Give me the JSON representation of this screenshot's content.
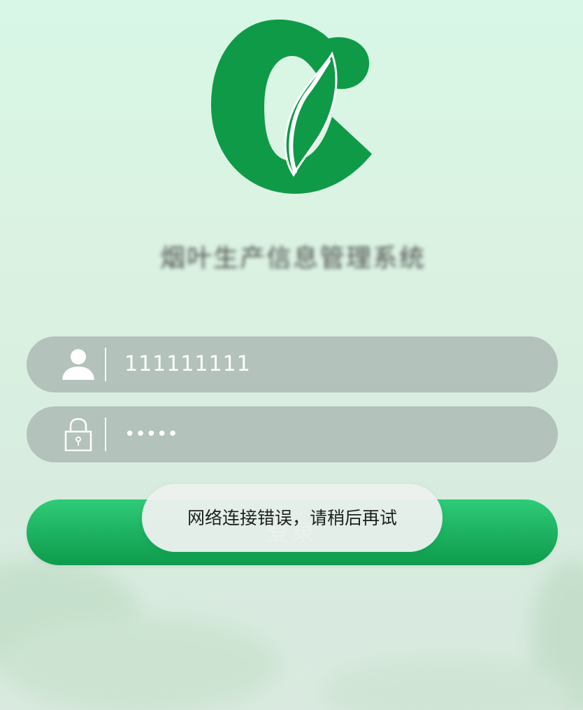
{
  "app": {
    "title": "烟叶生产信息管理系统",
    "logo": "green-c-leaf-logo"
  },
  "form": {
    "username": {
      "icon": "user-icon",
      "value": "111111111"
    },
    "password": {
      "icon": "lock-icon",
      "masked_value": "•••••"
    },
    "login_button": {
      "label": "登录"
    }
  },
  "toast": {
    "message": "网络连接错误，请稍后再试"
  },
  "colors": {
    "brand_green": "#0f9a48",
    "button_top": "#2fcc78",
    "button_bottom": "#0e9b4c",
    "field_bg": "#b3c2bb",
    "background": "#d8f2e3"
  }
}
